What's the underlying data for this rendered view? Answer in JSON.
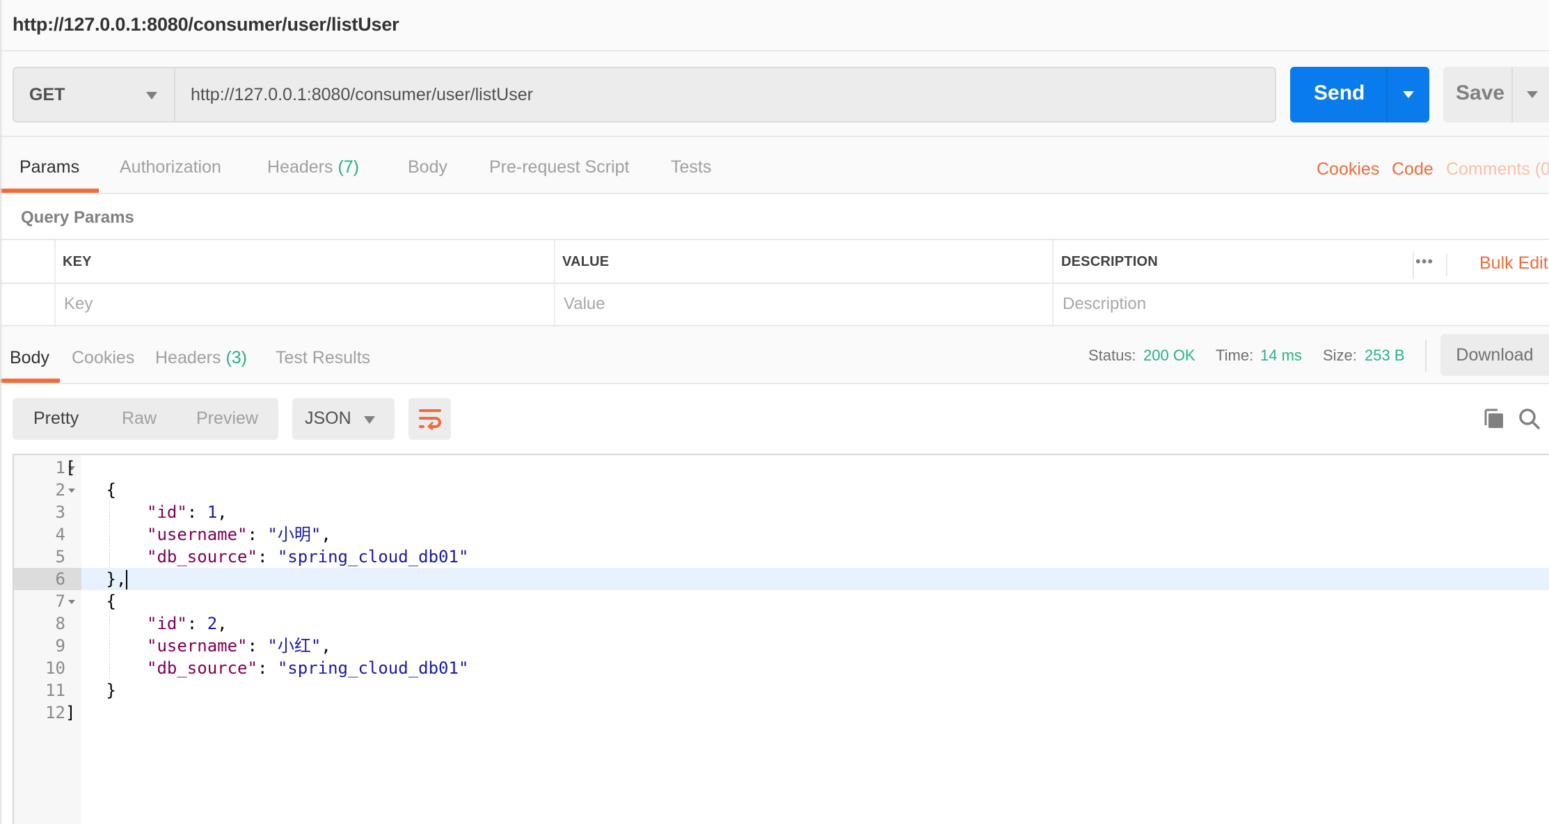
{
  "window": {
    "title": "http://127.0.0.1:8080/consumer/user/listUser"
  },
  "request": {
    "method": "GET",
    "url": "http://127.0.0.1:8080/consumer/user/listUser",
    "send_label": "Send",
    "save_label": "Save",
    "tabs": [
      {
        "label": "Params",
        "count": null,
        "active": true
      },
      {
        "label": "Authorization",
        "count": null,
        "active": false
      },
      {
        "label": "Headers",
        "count": "(7)",
        "active": false
      },
      {
        "label": "Body",
        "count": null,
        "active": false
      },
      {
        "label": "Pre-request Script",
        "count": null,
        "active": false
      },
      {
        "label": "Tests",
        "count": null,
        "active": false
      }
    ],
    "right_links": {
      "cookies": "Cookies",
      "code": "Code",
      "comments": "Comments (0"
    }
  },
  "query_params": {
    "title": "Query Params",
    "columns": [
      "KEY",
      "VALUE",
      "DESCRIPTION"
    ],
    "placeholders": {
      "key": "Key",
      "value": "Value",
      "description": "Description"
    },
    "more_icon": "•••",
    "bulk_edit": "Bulk Edit"
  },
  "response": {
    "tabs": [
      {
        "label": "Body",
        "count": null,
        "active": true
      },
      {
        "label": "Cookies",
        "count": null,
        "active": false
      },
      {
        "label": "Headers",
        "count": "(3)",
        "active": false
      },
      {
        "label": "Test Results",
        "count": null,
        "active": false
      }
    ],
    "meta": {
      "status_label": "Status:",
      "status_value": "200 OK",
      "time_label": "Time:",
      "time_value": "14 ms",
      "size_label": "Size:",
      "size_value": "253 B"
    },
    "download_label": "Download",
    "view_modes": [
      "Pretty",
      "Raw",
      "Preview"
    ],
    "active_view": "Pretty",
    "format": "JSON",
    "icons": {
      "wrap": "wrap-lines-icon",
      "copy": "copy-icon",
      "search": "search-icon"
    },
    "colors": {
      "accent": "#f26b3a",
      "send": "#097bed",
      "success": "#26b47f"
    },
    "body_lines": [
      {
        "n": "1",
        "fold": true,
        "indent": 0,
        "tokens": [
          {
            "t": "[",
            "c": "punc"
          }
        ]
      },
      {
        "n": "2",
        "fold": true,
        "indent": 1,
        "tokens": [
          {
            "t": "{",
            "c": "punc"
          }
        ]
      },
      {
        "n": "3",
        "fold": false,
        "indent": 2,
        "tokens": [
          {
            "t": "\"id\"",
            "c": "k"
          },
          {
            "t": ": ",
            "c": "punc"
          },
          {
            "t": "1",
            "c": "n"
          },
          {
            "t": ",",
            "c": "punc"
          }
        ]
      },
      {
        "n": "4",
        "fold": false,
        "indent": 2,
        "tokens": [
          {
            "t": "\"username\"",
            "c": "k"
          },
          {
            "t": ": ",
            "c": "punc"
          },
          {
            "t": "\"小明\"",
            "c": "s"
          },
          {
            "t": ",",
            "c": "punc"
          }
        ]
      },
      {
        "n": "5",
        "fold": false,
        "indent": 2,
        "tokens": [
          {
            "t": "\"db_source\"",
            "c": "k"
          },
          {
            "t": ": ",
            "c": "punc"
          },
          {
            "t": "\"spring_cloud_db01\"",
            "c": "s"
          }
        ]
      },
      {
        "n": "6",
        "fold": false,
        "indent": 1,
        "active": true,
        "tokens": [
          {
            "t": "},",
            "c": "punc"
          }
        ]
      },
      {
        "n": "7",
        "fold": true,
        "indent": 1,
        "tokens": [
          {
            "t": "{",
            "c": "punc"
          }
        ]
      },
      {
        "n": "8",
        "fold": false,
        "indent": 2,
        "tokens": [
          {
            "t": "\"id\"",
            "c": "k"
          },
          {
            "t": ": ",
            "c": "punc"
          },
          {
            "t": "2",
            "c": "n"
          },
          {
            "t": ",",
            "c": "punc"
          }
        ]
      },
      {
        "n": "9",
        "fold": false,
        "indent": 2,
        "tokens": [
          {
            "t": "\"username\"",
            "c": "k"
          },
          {
            "t": ": ",
            "c": "punc"
          },
          {
            "t": "\"小红\"",
            "c": "s"
          },
          {
            "t": ",",
            "c": "punc"
          }
        ]
      },
      {
        "n": "10",
        "fold": false,
        "indent": 2,
        "tokens": [
          {
            "t": "\"db_source\"",
            "c": "k"
          },
          {
            "t": ": ",
            "c": "punc"
          },
          {
            "t": "\"spring_cloud_db01\"",
            "c": "s"
          }
        ]
      },
      {
        "n": "11",
        "fold": false,
        "indent": 1,
        "tokens": [
          {
            "t": "}",
            "c": "punc"
          }
        ]
      },
      {
        "n": "12",
        "fold": false,
        "indent": 0,
        "tokens": [
          {
            "t": "]",
            "c": "punc"
          }
        ]
      }
    ]
  }
}
